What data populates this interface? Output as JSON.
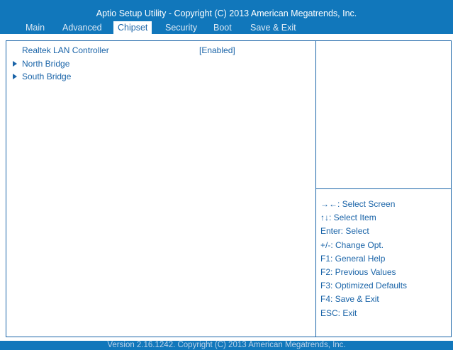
{
  "header": {
    "title": "Aptio Setup Utility - Copyright (C) 2013 American Megatrends, Inc.",
    "tabs": [
      {
        "label": "Main"
      },
      {
        "label": "Advanced"
      },
      {
        "label": "Chipset",
        "active": true
      },
      {
        "label": "Security"
      },
      {
        "label": "Boot"
      },
      {
        "label": "Save & Exit"
      }
    ]
  },
  "main": {
    "items": [
      {
        "label": "Realtek LAN Controller",
        "value": "[Enabled]",
        "icon": null
      },
      {
        "label": "North Bridge",
        "icon": "submenu-arrow-icon"
      },
      {
        "label": "South Bridge",
        "icon": "submenu-arrow-icon"
      }
    ]
  },
  "help": {
    "lines": [
      "→←: Select Screen",
      "↑↓: Select Item",
      "Enter: Select",
      "+/-: Change Opt.",
      "F1: General Help",
      "F2: Previous Values",
      "F3: Optimized Defaults",
      "F4: Save & Exit",
      "ESC: Exit"
    ]
  },
  "footer": {
    "text": "Version 2.16.1242. Copyright (C) 2013 American Megatrends, Inc."
  },
  "colors": {
    "accent": "#1177bb",
    "text": "#1a64a8",
    "background": "#ffffff"
  }
}
